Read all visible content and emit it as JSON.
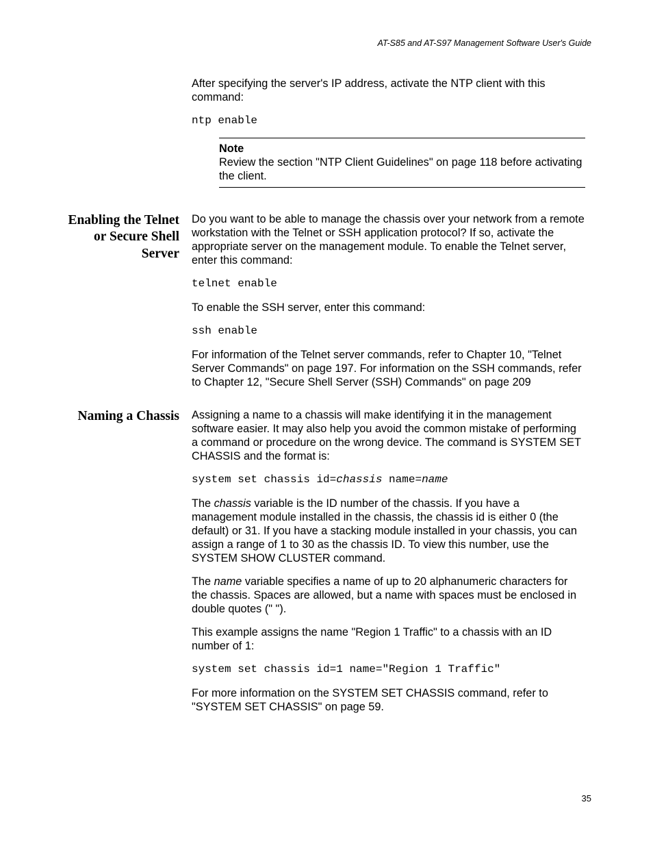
{
  "header": {
    "guide_title": "AT-S85 and AT-S97 Management Software User's Guide"
  },
  "intro": {
    "p1": "After specifying the server's IP address, activate the NTP client with this command:",
    "cmd1": "ntp enable",
    "note_label": "Note",
    "note_text": "Review the section \"NTP Client Guidelines\" on page 118 before activating the client."
  },
  "section1": {
    "heading": "Enabling the Telnet or Secure Shell Server",
    "p1": "Do you want to be able to manage the chassis over your network from a remote workstation with the Telnet or SSH application protocol? If so, activate the appropriate server on the management module. To enable the Telnet server, enter this command:",
    "cmd1": "telnet enable",
    "p2": "To enable the SSH server, enter this command:",
    "cmd2": "ssh enable",
    "p3": "For information of the Telnet server commands, refer to Chapter 10, \"Telnet Server Commands\" on page 197. For information on the SSH commands, refer to Chapter 12, \"Secure Shell Server (SSH) Commands\" on page 209"
  },
  "section2": {
    "heading": "Naming a Chassis",
    "p1": "Assigning a name to a chassis will make identifying it in the management software easier. It may also help you avoid the common mistake of performing a command or procedure on the wrong device. The command is SYSTEM SET CHASSIS and the format is:",
    "cmd1_a": "system set chassis id=",
    "cmd1_b": "chassis",
    "cmd1_c": " name=",
    "cmd1_d": "name",
    "p2_a": "The ",
    "p2_b": "chassis",
    "p2_c": " variable is the ID number of the chassis. If you have a management module installed in the chassis, the chassis id is either 0 (the default) or 31. If you have a stacking module installed in your chassis, you can assign a range of 1 to 30 as the chassis ID. To view this number, use the SYSTEM SHOW CLUSTER command.",
    "p3_a": "The ",
    "p3_b": "name",
    "p3_c": " variable specifies a name of up to 20 alphanumeric characters for the chassis. Spaces are allowed, but a name with spaces must be enclosed in double quotes (\" \").",
    "p4": "This example assigns the name \"Region 1 Traffic\" to a chassis with an ID number of 1:",
    "cmd2": "system set chassis id=1 name=\"Region 1 Traffic\"",
    "p5": "For more information on the SYSTEM SET CHASSIS command, refer to \"SYSTEM SET CHASSIS\" on page 59."
  },
  "page_number": "35"
}
